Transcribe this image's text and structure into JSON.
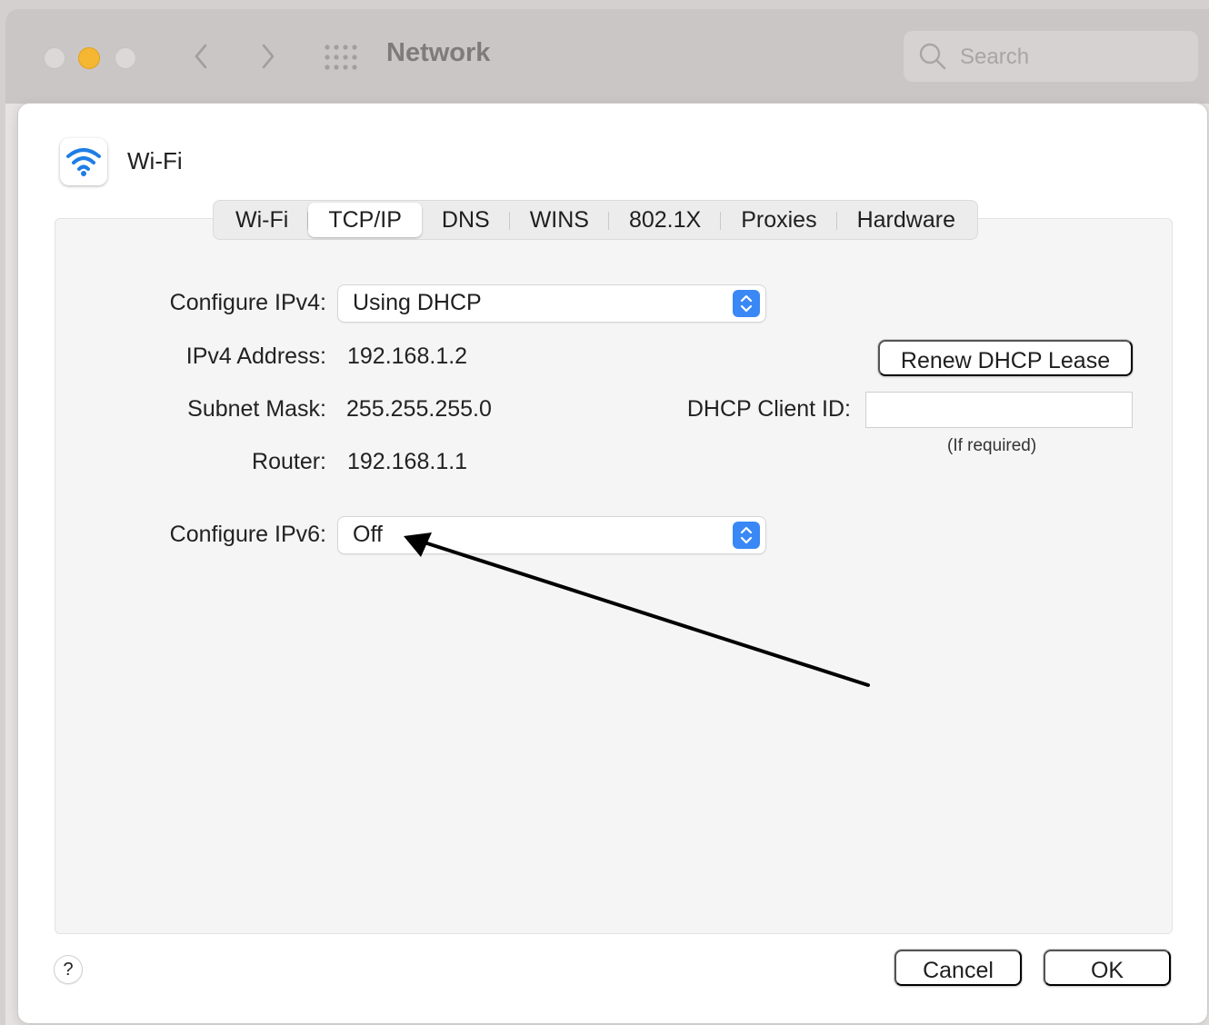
{
  "window": {
    "title": "Network",
    "search_placeholder": "Search"
  },
  "sheet": {
    "title": "Wi-Fi",
    "tabs": [
      {
        "label": "Wi-Fi"
      },
      {
        "label": "TCP/IP",
        "active": true
      },
      {
        "label": "DNS"
      },
      {
        "label": "WINS"
      },
      {
        "label": "802.1X"
      },
      {
        "label": "Proxies"
      },
      {
        "label": "Hardware"
      }
    ],
    "ipv4": {
      "configure_label": "Configure IPv4:",
      "configure_value": "Using DHCP",
      "address_label": "IPv4 Address:",
      "address_value": "192.168.1.2",
      "subnet_label": "Subnet Mask:",
      "subnet_value": "255.255.255.0",
      "router_label": "Router:",
      "router_value": "192.168.1.1",
      "renew_button": "Renew DHCP Lease",
      "client_id_label": "DHCP Client ID:",
      "client_id_value": "",
      "client_id_hint": "(If required)"
    },
    "ipv6": {
      "configure_label": "Configure IPv6:",
      "configure_value": "Off"
    },
    "footer": {
      "help": "?",
      "cancel": "Cancel",
      "ok": "OK"
    }
  },
  "colors": {
    "accent": "#3a88f5",
    "wifi_icon": "#1e7ee6",
    "minimize_light": "#f5b731"
  }
}
